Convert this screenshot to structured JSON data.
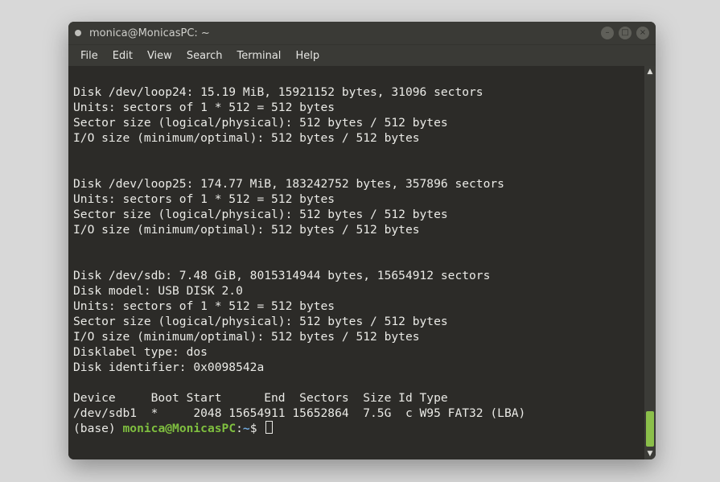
{
  "window": {
    "title": "monica@MonicasPC: ~"
  },
  "menubar": {
    "items": [
      "File",
      "Edit",
      "View",
      "Search",
      "Terminal",
      "Help"
    ]
  },
  "win_controls": {
    "minimize": "–",
    "maximize": "□",
    "close": "×"
  },
  "scrollbar": {
    "up_glyph": "▲",
    "down_glyph": "▼"
  },
  "terminal": {
    "lines": [
      "",
      "Disk /dev/loop24: 15.19 MiB, 15921152 bytes, 31096 sectors",
      "Units: sectors of 1 * 512 = 512 bytes",
      "Sector size (logical/physical): 512 bytes / 512 bytes",
      "I/O size (minimum/optimal): 512 bytes / 512 bytes",
      "",
      "",
      "Disk /dev/loop25: 174.77 MiB, 183242752 bytes, 357896 sectors",
      "Units: sectors of 1 * 512 = 512 bytes",
      "Sector size (logical/physical): 512 bytes / 512 bytes",
      "I/O size (minimum/optimal): 512 bytes / 512 bytes",
      "",
      "",
      "Disk /dev/sdb: 7.48 GiB, 8015314944 bytes, 15654912 sectors",
      "Disk model: USB DISK 2.0",
      "Units: sectors of 1 * 512 = 512 bytes",
      "Sector size (logical/physical): 512 bytes / 512 bytes",
      "I/O size (minimum/optimal): 512 bytes / 512 bytes",
      "Disklabel type: dos",
      "Disk identifier: 0x0098542a",
      "",
      "Device     Boot Start      End  Sectors  Size Id Type",
      "/dev/sdb1  *     2048 15654911 15652864  7.5G  c W95 FAT32 (LBA)"
    ],
    "prompt": {
      "base": "(base) ",
      "user": "monica",
      "at": "@",
      "host": "MonicasPC",
      "colon": ":",
      "path": "~",
      "dollar": "$"
    }
  }
}
